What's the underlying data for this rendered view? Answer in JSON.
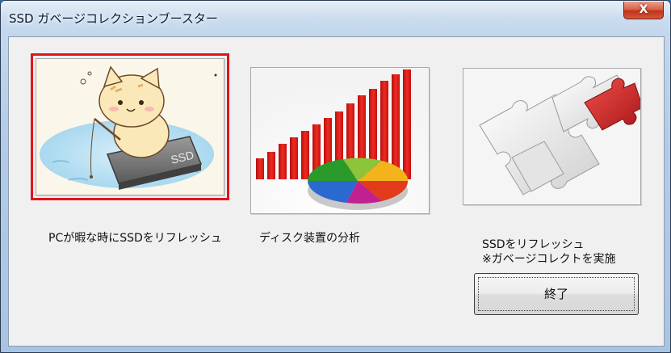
{
  "window": {
    "title": "SSD ガベージコレクションブースター",
    "close_label": "X"
  },
  "options": [
    {
      "caption": "PCが暇な時にSSDをリフレッシュ",
      "image": "cat-fishing-on-ssd",
      "selected": true
    },
    {
      "caption": "ディスク装置の分析",
      "image": "bar-and-pie-chart",
      "selected": false
    },
    {
      "caption_line1": "SSDをリフレッシュ",
      "caption_line2": "※ガベージコレクトを実施",
      "image": "jigsaw-puzzle",
      "selected": false
    }
  ],
  "buttons": {
    "exit_label": "終了"
  },
  "colors": {
    "selection_border": "#e0141a",
    "chart_red": "#e8231f",
    "puzzle_red": "#d42b2b"
  }
}
